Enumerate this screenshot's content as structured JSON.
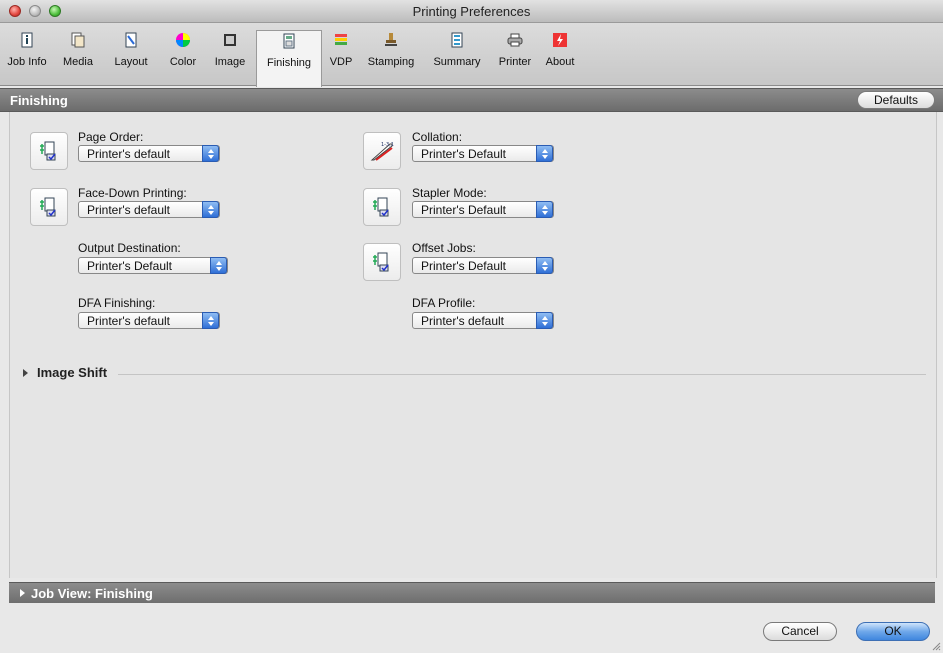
{
  "window": {
    "title": "Printing Preferences"
  },
  "toolbar": {
    "items": [
      {
        "label": "Job Info",
        "icon": "info-icon"
      },
      {
        "label": "Media",
        "icon": "media-icon"
      },
      {
        "label": "Layout",
        "icon": "layout-icon"
      },
      {
        "label": "Color",
        "icon": "color-wheel-icon"
      },
      {
        "label": "Image",
        "icon": "image-icon"
      },
      {
        "label": "Finishing",
        "icon": "finishing-icon",
        "active": true
      },
      {
        "label": "VDP",
        "icon": "vdp-icon"
      },
      {
        "label": "Stamping",
        "icon": "stamp-icon"
      },
      {
        "label": "Summary",
        "icon": "summary-icon"
      },
      {
        "label": "Printer",
        "icon": "printer-icon"
      },
      {
        "label": "About",
        "icon": "about-icon"
      }
    ]
  },
  "section": {
    "title": "Finishing",
    "defaults_label": "Defaults"
  },
  "fields": {
    "page_order": {
      "label": "Page Order:",
      "value": "Printer's default"
    },
    "face_down": {
      "label": "Face-Down Printing:",
      "value": "Printer's default"
    },
    "output_destination": {
      "label": "Output Destination:",
      "value": "Printer's Default"
    },
    "dfa_finishing": {
      "label": "DFA Finishing:",
      "value": "Printer's default"
    },
    "collation": {
      "label": "Collation:",
      "value": "Printer's Default"
    },
    "stapler_mode": {
      "label": "Stapler Mode:",
      "value": "Printer's Default"
    },
    "offset_jobs": {
      "label": "Offset Jobs:",
      "value": "Printer's Default"
    },
    "dfa_profile": {
      "label": "DFA Profile:",
      "value": "Printer's default"
    }
  },
  "image_shift": {
    "label": "Image Shift"
  },
  "job_view": {
    "label": "Job View: Finishing"
  },
  "buttons": {
    "cancel": "Cancel",
    "ok": "OK"
  },
  "colors": {
    "accent": "#3f86de",
    "section_bar": "#7a7a7a"
  }
}
